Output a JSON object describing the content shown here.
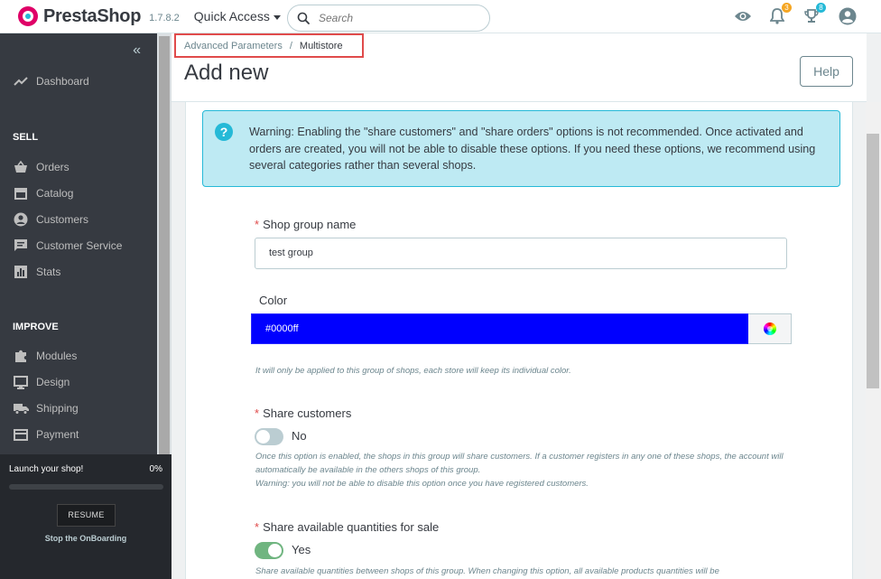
{
  "header": {
    "brand": "PrestaShop",
    "version": "1.7.8.2",
    "quick_access": "Quick Access",
    "search_placeholder": "Search",
    "notifications": [
      {
        "icon": "bell-icon",
        "count": "3",
        "color": "#f5a623"
      },
      {
        "icon": "trophy-icon",
        "count": "8",
        "color": "#25b9d7"
      }
    ]
  },
  "sidebar": {
    "collapse": "«",
    "dashboard": "Dashboard",
    "sections": [
      {
        "title": "SELL",
        "items": [
          "Orders",
          "Catalog",
          "Customers",
          "Customer Service",
          "Stats"
        ]
      },
      {
        "title": "IMPROVE",
        "items": [
          "Modules",
          "Design",
          "Shipping",
          "Payment"
        ]
      }
    ],
    "onboarding": {
      "title": "Launch your shop!",
      "percent": "0%",
      "progress": 0,
      "resume": "RESUME",
      "stop": "Stop the OnBoarding"
    }
  },
  "breadcrumb": {
    "parent": "Advanced Parameters",
    "separator": "/",
    "current": "Multistore"
  },
  "page": {
    "title": "Add new",
    "help": "Help"
  },
  "form": {
    "alert": "Warning: Enabling the \"share customers\" and \"share orders\" options is not recommended. Once activated and orders are created, you will not be able to disable these options. If you need these options, we recommend using several categories rather than several shops.",
    "shop_group_label": "Shop group name",
    "shop_group_value": "test group",
    "color_label": "Color",
    "color_value": "#0000ff",
    "color_help": "It will only be applied to this group of shops, each store will keep its individual color.",
    "share_customers_label": "Share customers",
    "share_customers_state": "No",
    "share_customers_enabled": false,
    "share_customers_help_1": "Once this option is enabled, the shops in this group will share customers. If a customer registers in any one of these shops, the account will automatically be available in the others shops of this group.",
    "share_customers_help_2": "Warning: you will not be able to disable this option once you have registered customers.",
    "share_qty_label": "Share available quantities for sale",
    "share_qty_state": "Yes",
    "share_qty_enabled": true,
    "share_qty_help": "Share available quantities between shops of this group. When changing this option, all available products quantities will be"
  },
  "colors": {
    "brand": "#df0067",
    "primary": "#25b9d7",
    "success": "#70b580",
    "danger": "#e04b4b",
    "sidebar": "#363a41"
  }
}
